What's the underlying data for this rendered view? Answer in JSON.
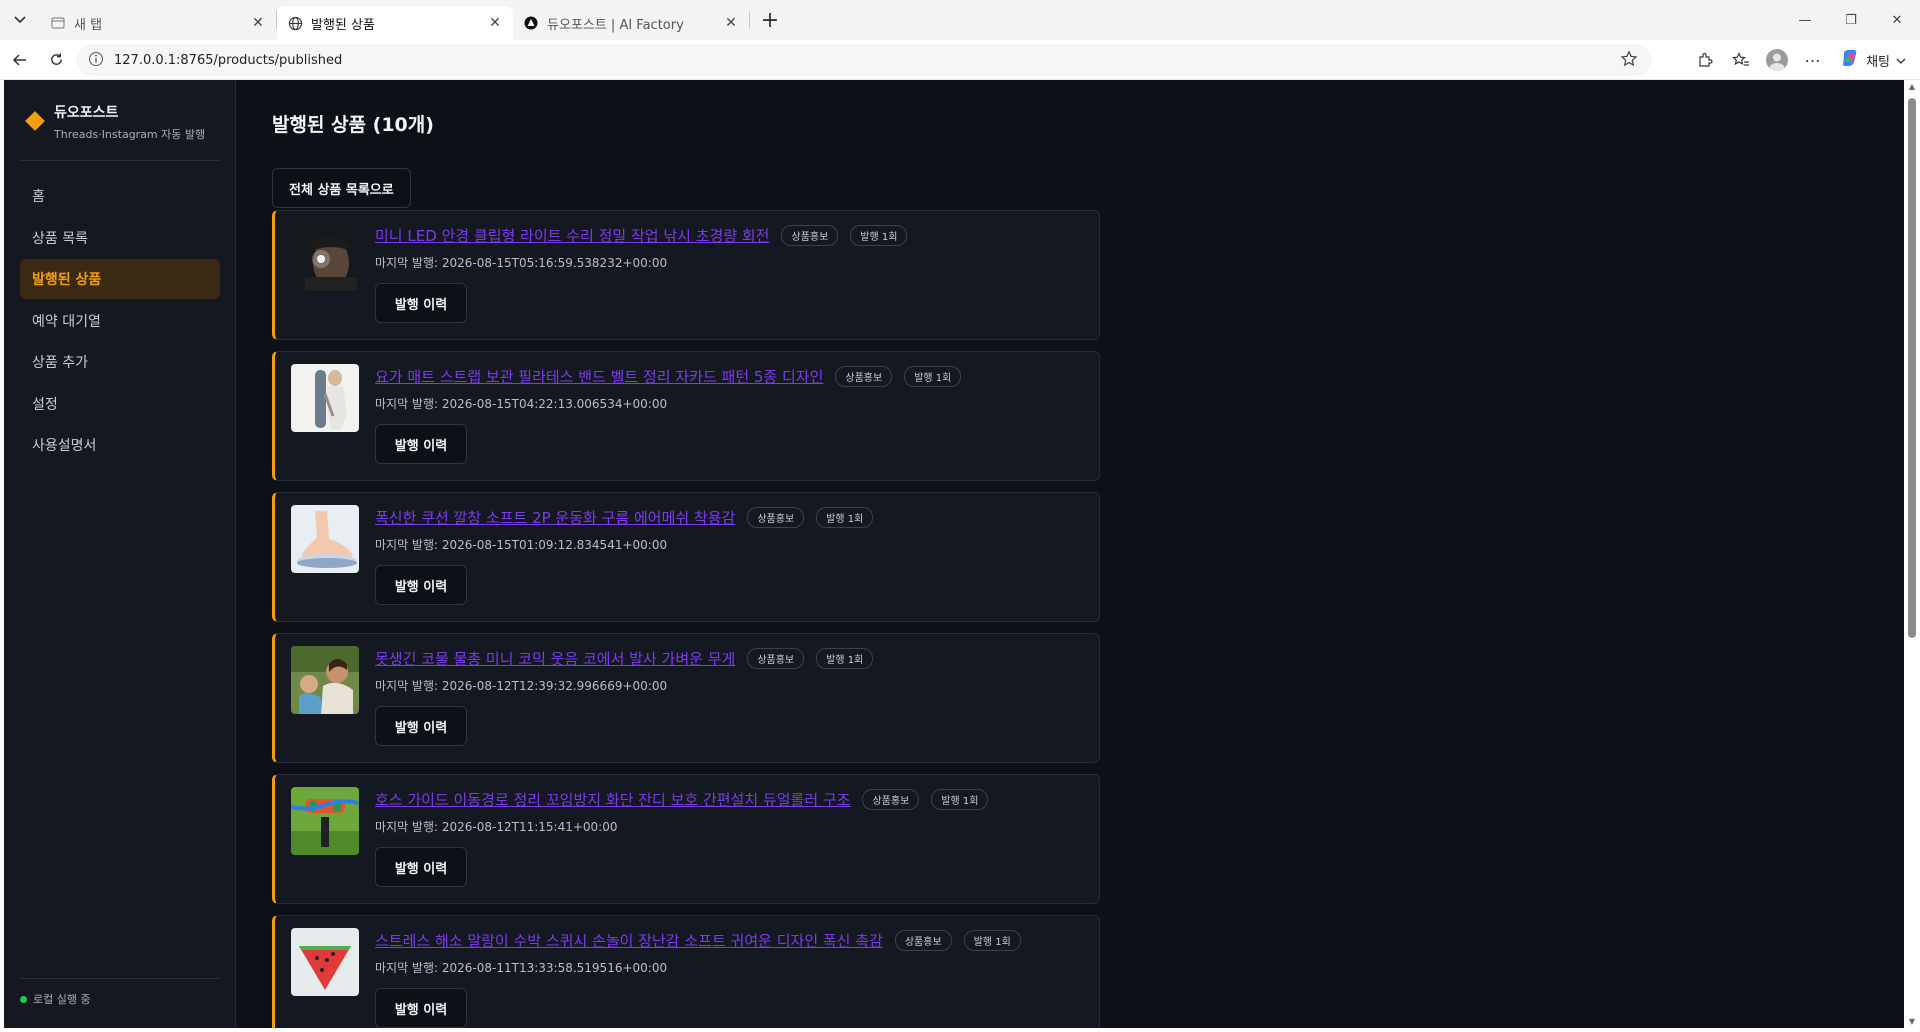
{
  "browser": {
    "tabs": [
      {
        "title": "새 탭",
        "icon": "new-tab-icon"
      },
      {
        "title": "발행된 상품",
        "icon": "globe-icon"
      },
      {
        "title": "듀오포스트 | AI Factory",
        "icon": "ai-factory-icon"
      }
    ],
    "url": "127.0.0.1:8765/products/published",
    "copilot_label": "채팅"
  },
  "app": {
    "brand_name": "듀오포스트",
    "brand_sub": "Threads·Instagram 자동 발행",
    "accent": "#f59e0b",
    "nav": [
      "홈",
      "상품 목록",
      "발행된 상품",
      "예약 대기열",
      "상품 추가",
      "설정",
      "사용설명서"
    ],
    "active_nav": "발행된 상품",
    "footer_status": "로컬 실행 중"
  },
  "page": {
    "title": "발행된 상품 (10개)",
    "back_button": "전체 상품 목록으로",
    "history_button": "발행 이력",
    "last_pub_prefix": "마지막 발행: "
  },
  "products": [
    {
      "title": "미니 LED 안경 클립형 라이트 수리 정밀 작업 낚시 초경량 회전",
      "tag": "상품홍보",
      "count": "발행 1회",
      "last": "2026-08-15T05:16:59.538232+00:00"
    },
    {
      "title": "요가 매트 스트랩 보관 필라테스 밴드 벨트 정리 자카드 패턴 5종 디자인",
      "tag": "상품홍보",
      "count": "발행 1회",
      "last": "2026-08-15T04:22:13.006534+00:00"
    },
    {
      "title": "폭신한 쿠션 깔창 소프트 2P 운동화 구름 에어메쉬 착용감",
      "tag": "상품홍보",
      "count": "발행 1회",
      "last": "2026-08-15T01:09:12.834541+00:00"
    },
    {
      "title": "못생긴 코물 물총 미니 코믹 웃음 코에서 발사 가벼운 무게",
      "tag": "상품홍보",
      "count": "발행 1회",
      "last": "2026-08-12T12:39:32.996669+00:00"
    },
    {
      "title": "호스 가이드 이동경로 정리 꼬임방지 화단 잔디 보호 간편설치 듀얼롤러 구조",
      "tag": "상품홍보",
      "count": "발행 1회",
      "last": "2026-08-12T11:15:41+00:00"
    },
    {
      "title": "스트레스 해소 말랑이 수박 스퀴시 손놀이 장난감 소프트 귀여운 디자인 폭신 촉감",
      "tag": "상품홍보",
      "count": "발행 1회",
      "last": "2026-08-11T13:33:58.519516+00:00"
    }
  ]
}
